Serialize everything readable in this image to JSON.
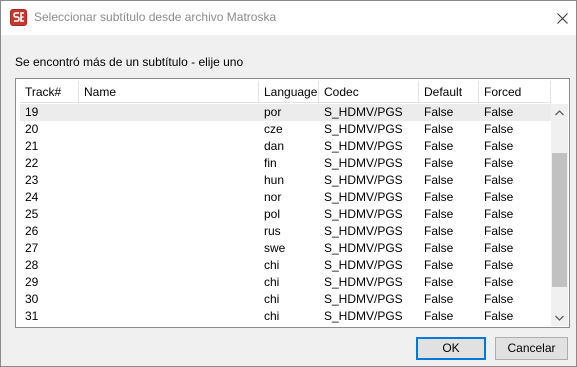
{
  "window": {
    "title": "Seleccionar subtítulo desde archivo Matroska",
    "prompt": "Se encontró más de un subtítulo - elije uno"
  },
  "table": {
    "columns": {
      "track": "Track#",
      "name": "Name",
      "language": "Language",
      "codec": "Codec",
      "default": "Default",
      "forced": "Forced"
    },
    "rows": [
      {
        "track": "19",
        "name": "",
        "language": "por",
        "codec": "S_HDMV/PGS",
        "default": "False",
        "forced": "False"
      },
      {
        "track": "20",
        "name": "",
        "language": "cze",
        "codec": "S_HDMV/PGS",
        "default": "False",
        "forced": "False"
      },
      {
        "track": "21",
        "name": "",
        "language": "dan",
        "codec": "S_HDMV/PGS",
        "default": "False",
        "forced": "False"
      },
      {
        "track": "22",
        "name": "",
        "language": "fin",
        "codec": "S_HDMV/PGS",
        "default": "False",
        "forced": "False"
      },
      {
        "track": "23",
        "name": "",
        "language": "hun",
        "codec": "S_HDMV/PGS",
        "default": "False",
        "forced": "False"
      },
      {
        "track": "24",
        "name": "",
        "language": "nor",
        "codec": "S_HDMV/PGS",
        "default": "False",
        "forced": "False"
      },
      {
        "track": "25",
        "name": "",
        "language": "pol",
        "codec": "S_HDMV/PGS",
        "default": "False",
        "forced": "False"
      },
      {
        "track": "26",
        "name": "",
        "language": "rus",
        "codec": "S_HDMV/PGS",
        "default": "False",
        "forced": "False"
      },
      {
        "track": "27",
        "name": "",
        "language": "swe",
        "codec": "S_HDMV/PGS",
        "default": "False",
        "forced": "False"
      },
      {
        "track": "28",
        "name": "",
        "language": "chi",
        "codec": "S_HDMV/PGS",
        "default": "False",
        "forced": "False"
      },
      {
        "track": "29",
        "name": "",
        "language": "chi",
        "codec": "S_HDMV/PGS",
        "default": "False",
        "forced": "False"
      },
      {
        "track": "30",
        "name": "",
        "language": "chi",
        "codec": "S_HDMV/PGS",
        "default": "False",
        "forced": "False"
      },
      {
        "track": "31",
        "name": "",
        "language": "chi",
        "codec": "S_HDMV/PGS",
        "default": "False",
        "forced": "False"
      }
    ],
    "scroll_position": 0.6
  },
  "buttons": {
    "ok": "OK",
    "cancel": "Cancelar"
  },
  "icons": {
    "app": "subtitle-edit-app-icon",
    "close": "close-icon",
    "scroll_up": "chevron-up-icon",
    "scroll_down": "chevron-down-icon"
  },
  "colors": {
    "app_icon": "#c8362f",
    "default_button_border": "#0078d7"
  }
}
